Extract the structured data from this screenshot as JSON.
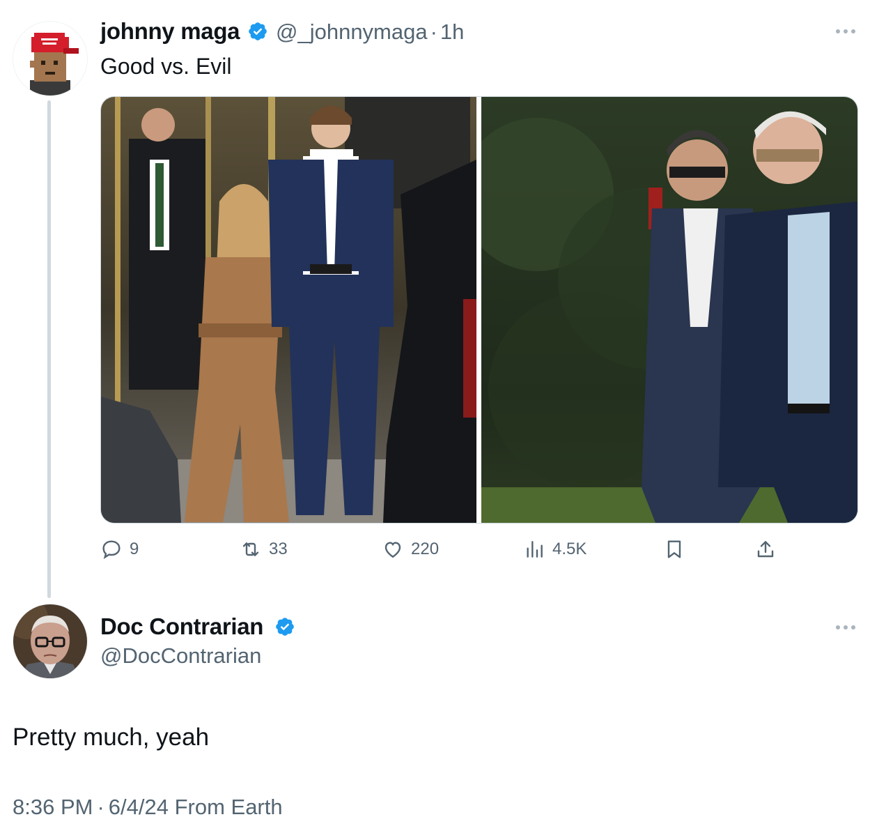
{
  "original_tweet": {
    "display_name": "johnny maga",
    "handle": "@_johnnymaga",
    "separator": "·",
    "time_ago": "1h",
    "text": "Good vs. Evil",
    "avatar_icon": "pixel-avatar-red-cap-icon",
    "verified_icon": "verified-badge-icon",
    "more_icon": "more-options-icon",
    "media": [
      {
        "description_icon": "photo-icon",
        "alt": "photo 1"
      },
      {
        "description_icon": "photo-icon",
        "alt": "photo 2"
      }
    ],
    "actions": {
      "replies": "9",
      "reposts": "33",
      "likes": "220",
      "views": "4.5K"
    }
  },
  "reply_tweet": {
    "display_name": "Doc Contrarian",
    "handle": "@DocContrarian",
    "text": "Pretty much, yeah",
    "timestamp": "8:36 PM",
    "separator": "·",
    "date_source": "6/4/24 From Earth",
    "avatar_icon": "elderly-man-glasses-avatar-icon",
    "verified_icon": "verified-badge-icon",
    "more_icon": "more-options-icon"
  },
  "colors": {
    "text_primary": "#0f1419",
    "text_secondary": "#536471",
    "verified_blue": "#1d9bf0",
    "thread_line": "#cfd9de"
  }
}
